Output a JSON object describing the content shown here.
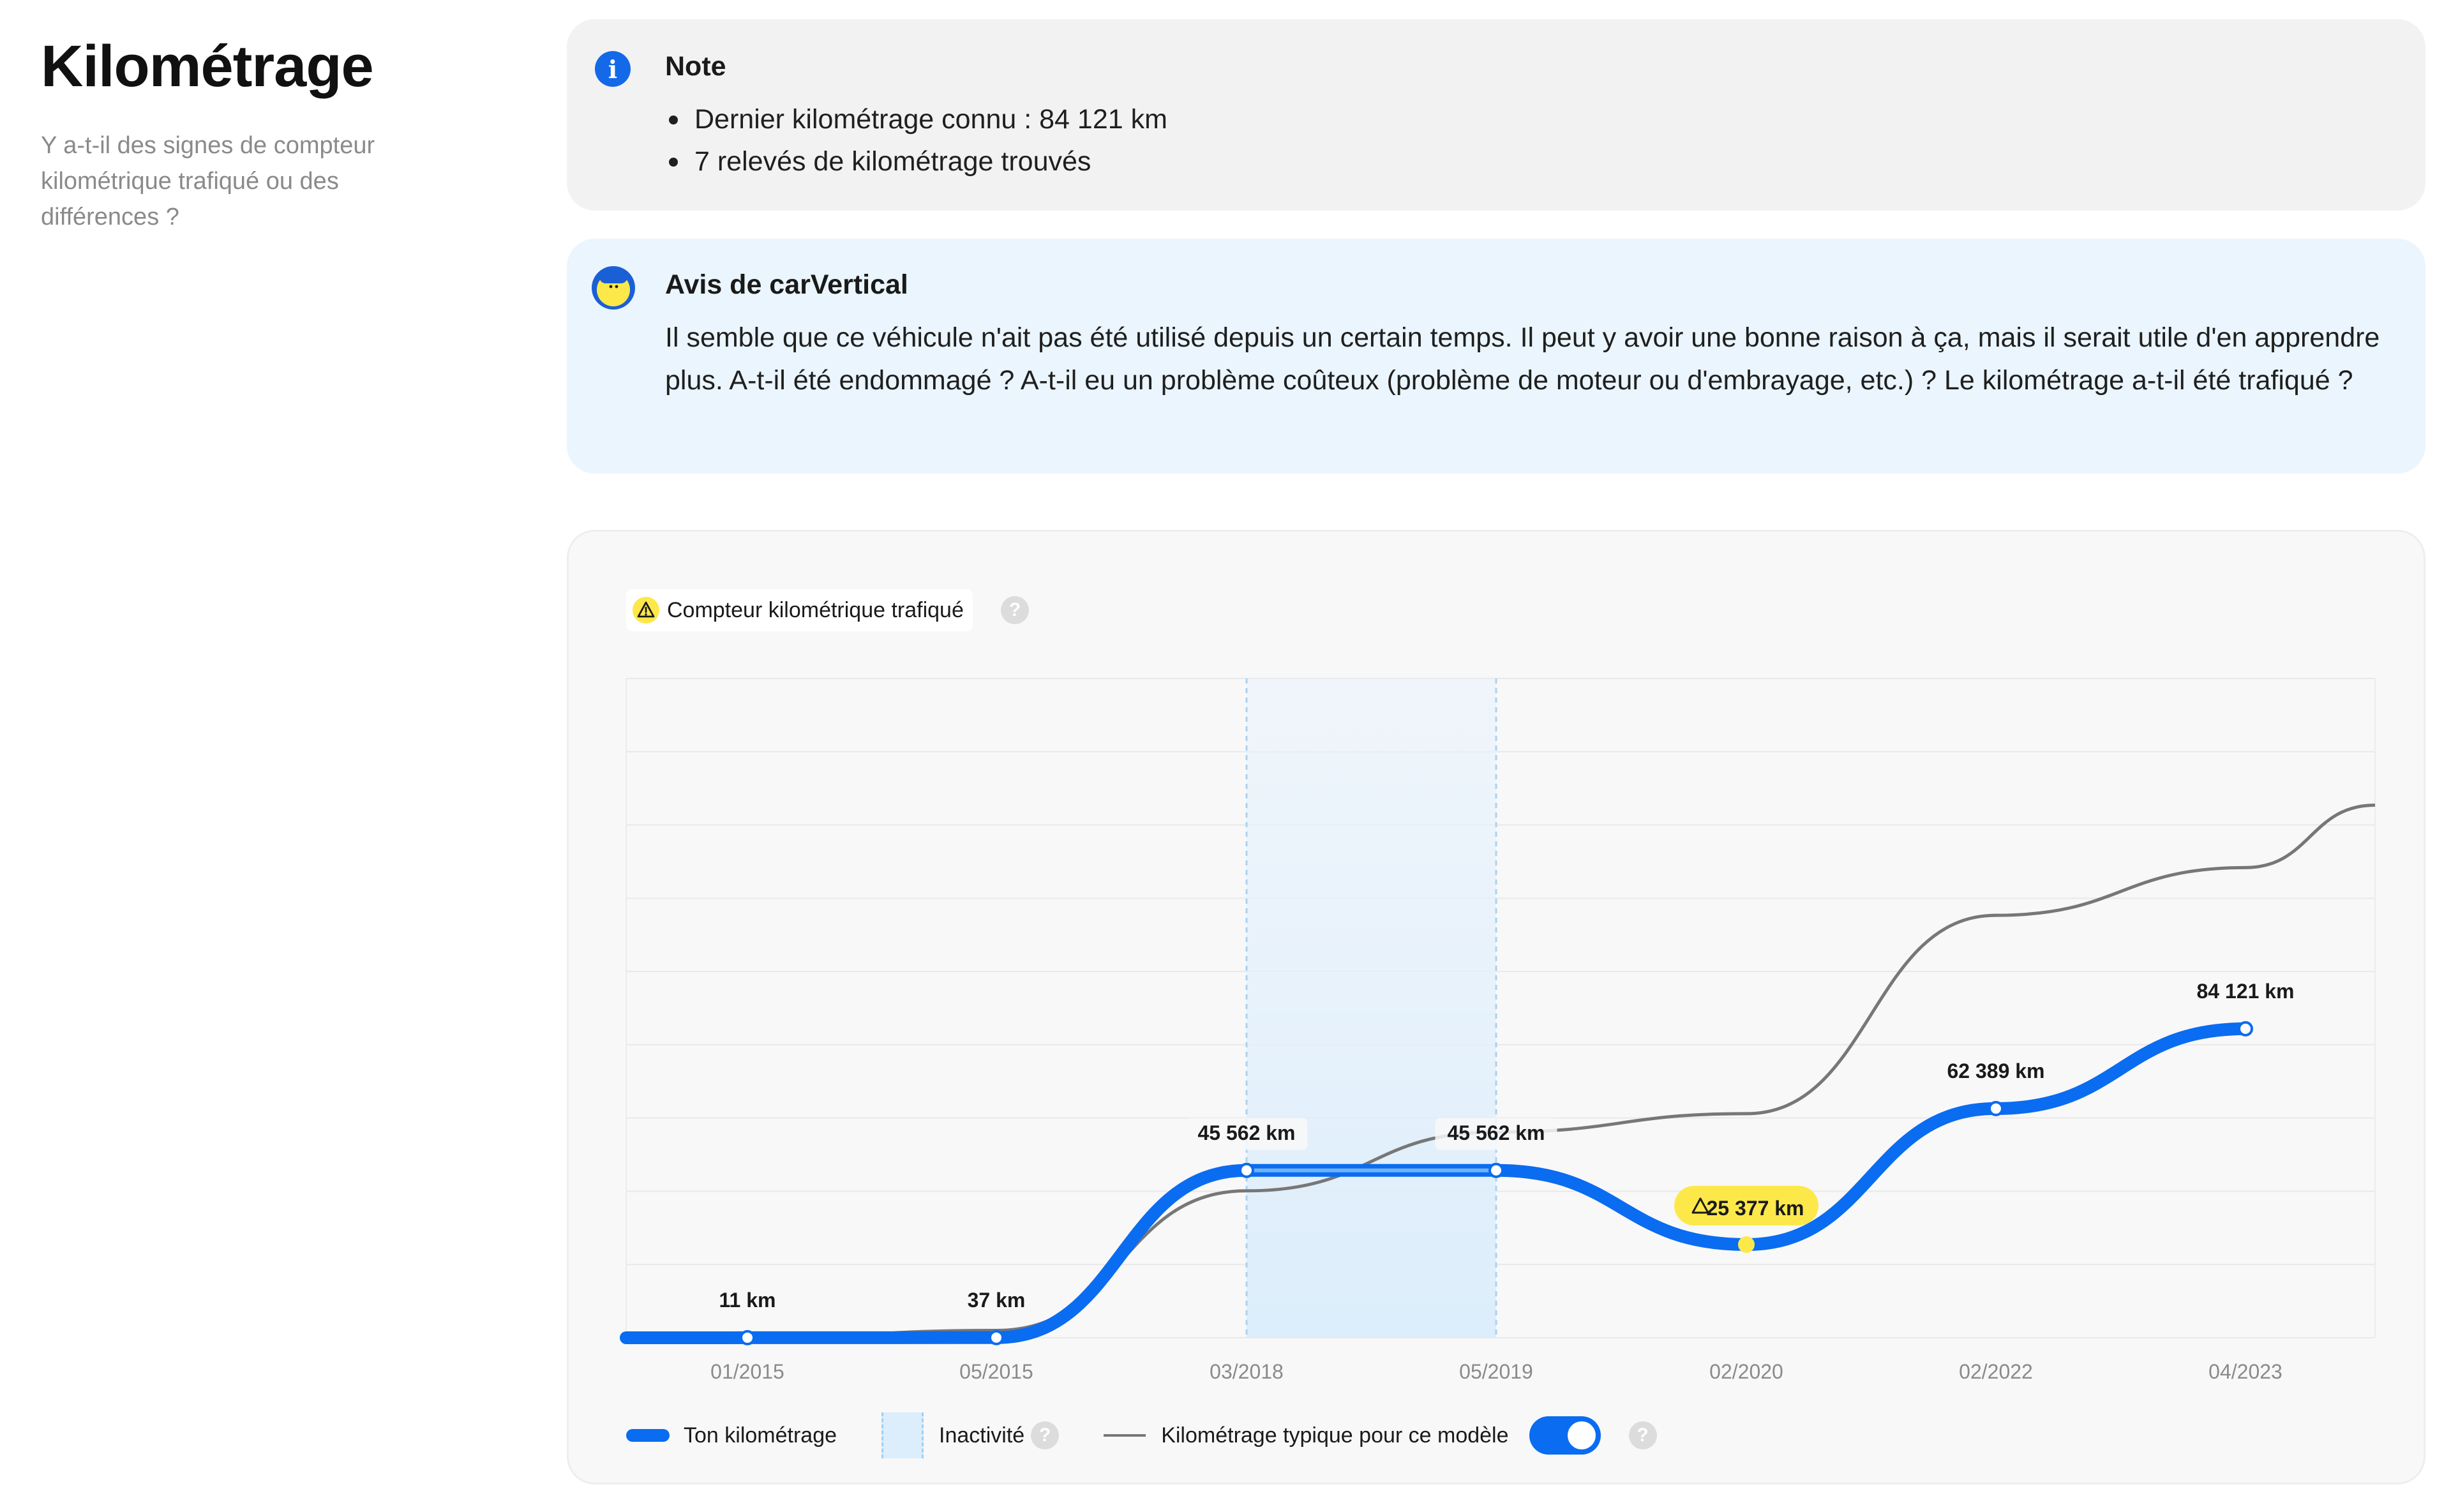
{
  "section": {
    "title": "Kilométrage",
    "subtitle": "Y a-t-il des signes de compteur kilométrique trafiqué ou des différences ?"
  },
  "note": {
    "title": "Note",
    "items": [
      "Dernier kilométrage connu : 84 121 km",
      "7 relevés de kilométrage trouvés"
    ]
  },
  "avis": {
    "title": "Avis de carVertical",
    "text": "Il semble que ce véhicule n'ait pas été utilisé depuis un certain temps. Il peut y avoir une bonne raison à ça, mais il serait utile d'en apprendre plus. A-t-il été endommagé ? A-t-il eu un problème coûteux (problème de moteur ou d'embrayage, etc.) ? Le kilométrage a-t-il été trafiqué ?"
  },
  "chart_badge": {
    "label": "Compteur kilométrique trafiqué",
    "help": "?"
  },
  "legend": {
    "mileage": "Ton kilométrage",
    "inactivity": "Inactivité",
    "typical": "Kilométrage typique pour ce modèle",
    "help": "?",
    "toggle_on": true
  },
  "colors": {
    "accent": "#0a6cf0",
    "typical_line": "#777777",
    "inactivity_fill": "#dcedfb",
    "warning": "#fde84a",
    "info": "#1469e8"
  },
  "chart_data": {
    "type": "line",
    "x": [
      "01/2015",
      "05/2015",
      "03/2018",
      "05/2019",
      "02/2020",
      "02/2022",
      "04/2023"
    ],
    "series": [
      {
        "name": "Ton kilométrage",
        "values": [
          11,
          37,
          45562,
          45562,
          25377,
          62389,
          84121
        ],
        "labels": [
          "11 km",
          "37 km",
          "45 562 km",
          "45 562 km",
          "25 377 km",
          "62 389 km",
          "84 121 km"
        ],
        "flagged_index": 4
      },
      {
        "name": "Kilométrage typique pour ce modèle",
        "values": [
          0,
          2000,
          40000,
          56000,
          61000,
          115000,
          128000
        ]
      }
    ],
    "inactivity_range": [
      "03/2018",
      "05/2019"
    ],
    "ylim": [
      0,
      140000
    ],
    "grid": true
  }
}
